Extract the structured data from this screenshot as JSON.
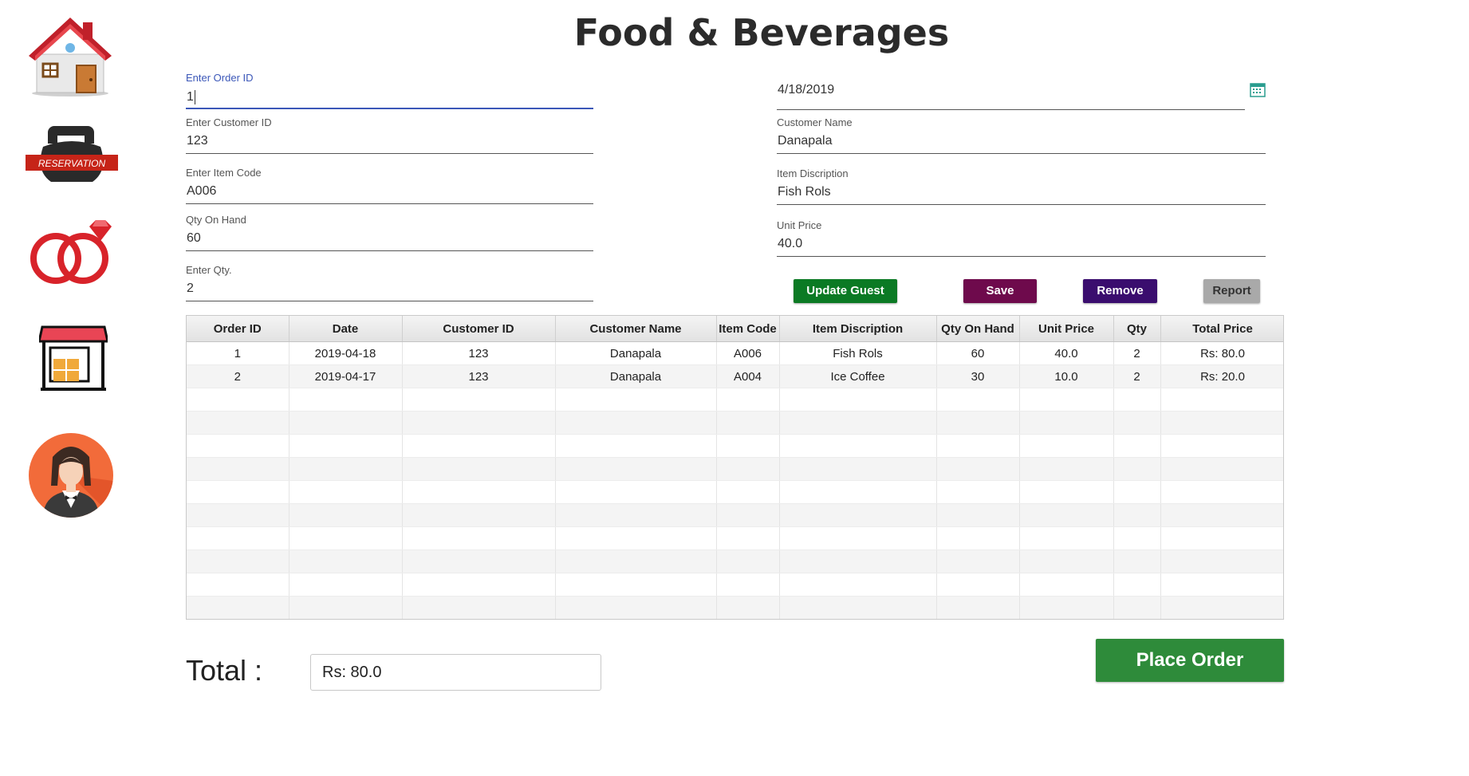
{
  "page": {
    "title": "Food & Beverages"
  },
  "sidebar": {
    "items": [
      {
        "icon": "home-icon"
      },
      {
        "icon": "reservation-icon",
        "label": "RESERVATION"
      },
      {
        "icon": "wedding-rings-icon"
      },
      {
        "icon": "store-icon"
      },
      {
        "icon": "waiter-icon"
      }
    ]
  },
  "form": {
    "order_id": {
      "label": "Enter Order ID",
      "value": "1"
    },
    "date": {
      "value": "4/18/2019"
    },
    "customer_id": {
      "label": "Enter Customer ID",
      "value": "123"
    },
    "customer_name": {
      "label": "Customer Name",
      "value": "Danapala"
    },
    "item_code": {
      "label": "Enter Item Code",
      "value": "A006"
    },
    "item_description": {
      "label": "Item Discription",
      "value": "Fish Rols"
    },
    "qty_on_hand": {
      "label": "Qty On Hand",
      "value": "60"
    },
    "unit_price": {
      "label": "Unit Price",
      "value": "40.0"
    },
    "qty": {
      "label": "Enter Qty.",
      "value": "2"
    }
  },
  "buttons": {
    "update_guest": "Update Guest",
    "save": "Save",
    "remove": "Remove",
    "report": "Report",
    "place_order": "Place Order"
  },
  "colors": {
    "update_guest": "#0b7a24",
    "save": "#6e0a4c",
    "remove": "#3a0d6e",
    "report": "#a9a9a9",
    "place_order": "#2e8b3a",
    "focus": "#3b57b8"
  },
  "table": {
    "columns": [
      "Order ID",
      "Date",
      "Customer ID",
      "Customer Name",
      "Item Code",
      "Item Discription",
      "Qty On Hand",
      "Unit Price",
      "Qty",
      "Total Price"
    ],
    "rows": [
      [
        "1",
        "2019-04-18",
        "123",
        "Danapala",
        "A006",
        "Fish Rols",
        "60",
        "40.0",
        "2",
        "Rs: 80.0"
      ],
      [
        "2",
        "2019-04-17",
        "123",
        "Danapala",
        "A004",
        "Ice Coffee",
        "30",
        "10.0",
        "2",
        "Rs: 20.0"
      ]
    ]
  },
  "total": {
    "label": "Total :",
    "value": "Rs: 80.0"
  }
}
